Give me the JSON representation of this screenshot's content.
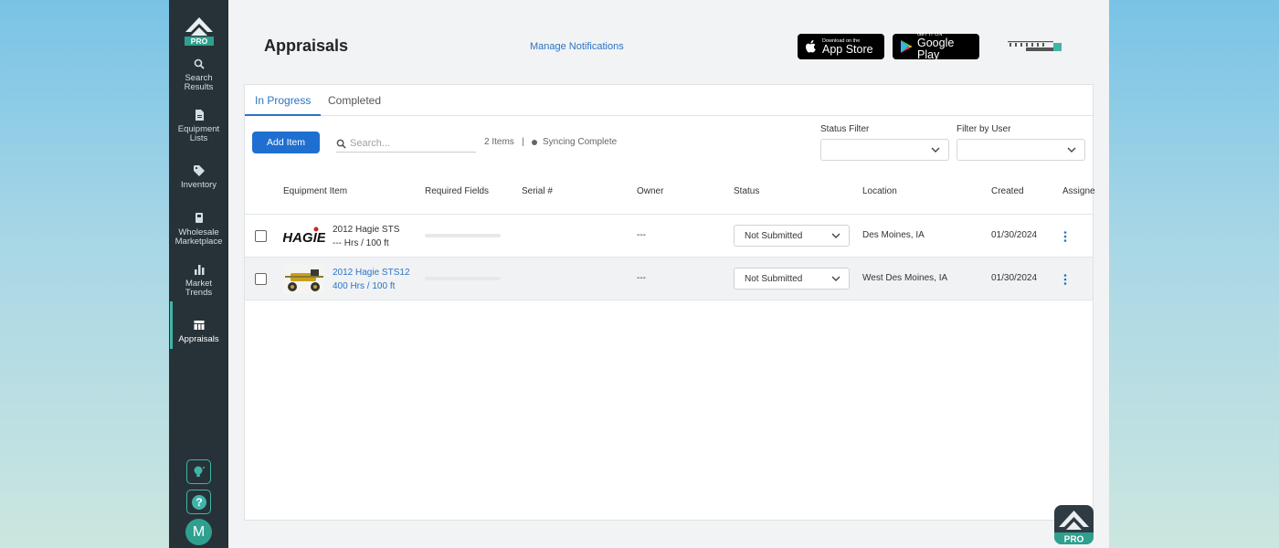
{
  "sidebar": {
    "logo_badge": "PRO",
    "items": [
      {
        "label_line1": "Search",
        "label_line2": "Results",
        "icon": "search-icon"
      },
      {
        "label_line1": "Equipment",
        "label_line2": "Lists",
        "icon": "document-icon"
      },
      {
        "label_line1": "Inventory",
        "label_line2": "",
        "icon": "tag-icon"
      },
      {
        "label_line1": "Wholesale",
        "label_line2": "Marketplace",
        "icon": "book-icon"
      },
      {
        "label_line1": "Market",
        "label_line2": "Trends",
        "icon": "bar-chart-icon"
      },
      {
        "label_line1": "Appraisals",
        "label_line2": "",
        "icon": "table-icon"
      }
    ],
    "avatar_initial": "M",
    "accent": "#3fb5a8"
  },
  "header": {
    "title": "Appraisals",
    "manage_notifications": "Manage Notifications",
    "app_store_small": "Download on the",
    "app_store_big": "App Store",
    "google_play_small": "GET IT ON",
    "google_play_big": "Google Play"
  },
  "tabs": [
    "In Progress",
    "Completed"
  ],
  "toolbar": {
    "add_item": "Add Item",
    "search_placeholder": "Search...",
    "items_count": "2 Items",
    "separator": "|",
    "sync_status": "Syncing Complete",
    "status_filter_label": "Status Filter",
    "user_filter_label": "Filter by User"
  },
  "table": {
    "columns": [
      "Equipment Item",
      "Required Fields",
      "Serial #",
      "Owner",
      "Status",
      "Location",
      "Created",
      "Assigne"
    ],
    "rows": [
      {
        "name": "2012 Hagie STS",
        "subtitle": "--- Hrs / 100 ft",
        "thumb_text": "HAGIE",
        "required_progress": 0,
        "serial": "",
        "owner": "---",
        "status": "Not Submitted",
        "location": "Des Moines, IA",
        "created": "01/30/2024"
      },
      {
        "name": "2012 Hagie STS12",
        "subtitle": "400 Hrs / 100 ft",
        "thumb_text": "",
        "required_progress": 0,
        "serial": "",
        "owner": "---",
        "status": "Not Submitted",
        "location": "West Des Moines, IA",
        "created": "01/30/2024"
      }
    ]
  },
  "pro_badge": "PRO",
  "colors": {
    "primary": "#1f6fd1",
    "link": "#2a74c6",
    "sidebar_bg": "#273238",
    "accent": "#3fb5a8"
  }
}
